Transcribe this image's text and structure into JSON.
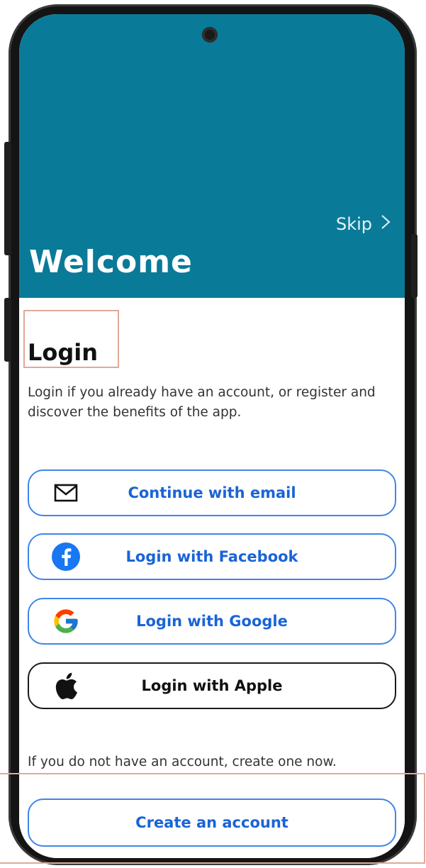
{
  "header": {
    "skip_label": "Skip",
    "skip_icon": "chevron-right-icon",
    "welcome_title": "Welcome"
  },
  "login": {
    "title": "Login",
    "description": "Login if you already have an account, or register and discover the benefits of the app."
  },
  "buttons": {
    "email": {
      "label": "Continue with email",
      "icon": "mail-icon"
    },
    "facebook": {
      "label": "Login with Facebook",
      "icon": "facebook-icon"
    },
    "google": {
      "label": "Login with Google",
      "icon": "google-icon"
    },
    "apple": {
      "label": "Login with Apple",
      "icon": "apple-icon"
    }
  },
  "signup": {
    "prompt": "If you do not have an account, create one now.",
    "create_label": "Create an account"
  },
  "colors": {
    "hero_bg": "#0a7a99",
    "button_border": "#3f86e6",
    "button_text": "#1a64d6",
    "facebook_blue": "#1877f2",
    "highlight": "#e0a999"
  }
}
